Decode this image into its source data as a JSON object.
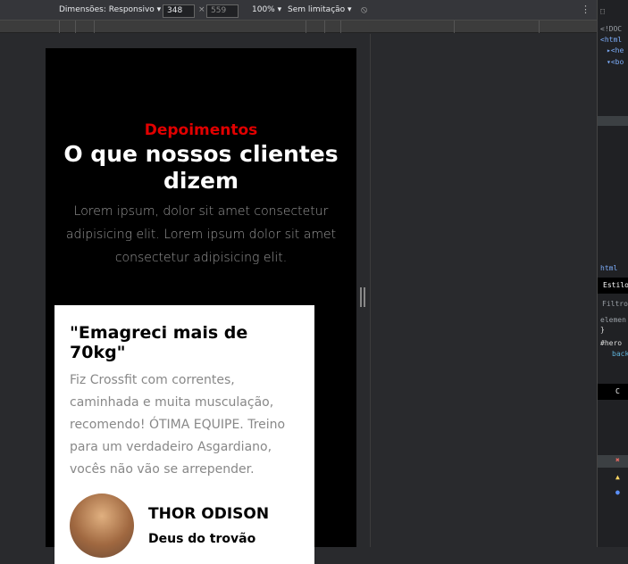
{
  "toolbar": {
    "dimensions_label": "Dimensões: Responsivo ▾",
    "width": "348",
    "height": "559",
    "times": "×",
    "zoom": "100% ▾",
    "throttle": "Sem limitação ▾",
    "rotate_icon": "rotate-icon",
    "more_icon": "kebab-icon"
  },
  "page": {
    "pretitle": "Depoimentos",
    "title": "O que nossos clientes dizem",
    "lead": "Lorem ipsum, dolor sit amet consectetur adipisicing elit. Lorem ipsum dolor sit amet consectetur adipisicing elit.",
    "testimonial": {
      "quote": "\"Emagreci mais de 70kg\"",
      "text": "Fiz Crossfit com correntes, caminhada e muita musculação, recomendo! ÓTIMA EQUIPE. Treino para um verdadeiro Asgardiano, vocês não vão se arrepender.",
      "name": "THOR ODISON",
      "role": "Deus do trovão"
    }
  },
  "devtools": {
    "doctype": "<!DOC",
    "html": "<html",
    "head": "▸<he",
    "body": "▾<bo",
    "crumb": "html",
    "styles_tab": "Estilos",
    "filter": "Filtro",
    "element": "elemen",
    "brace": "}",
    "hero": "#hero",
    "back": "back",
    "console": "C"
  }
}
